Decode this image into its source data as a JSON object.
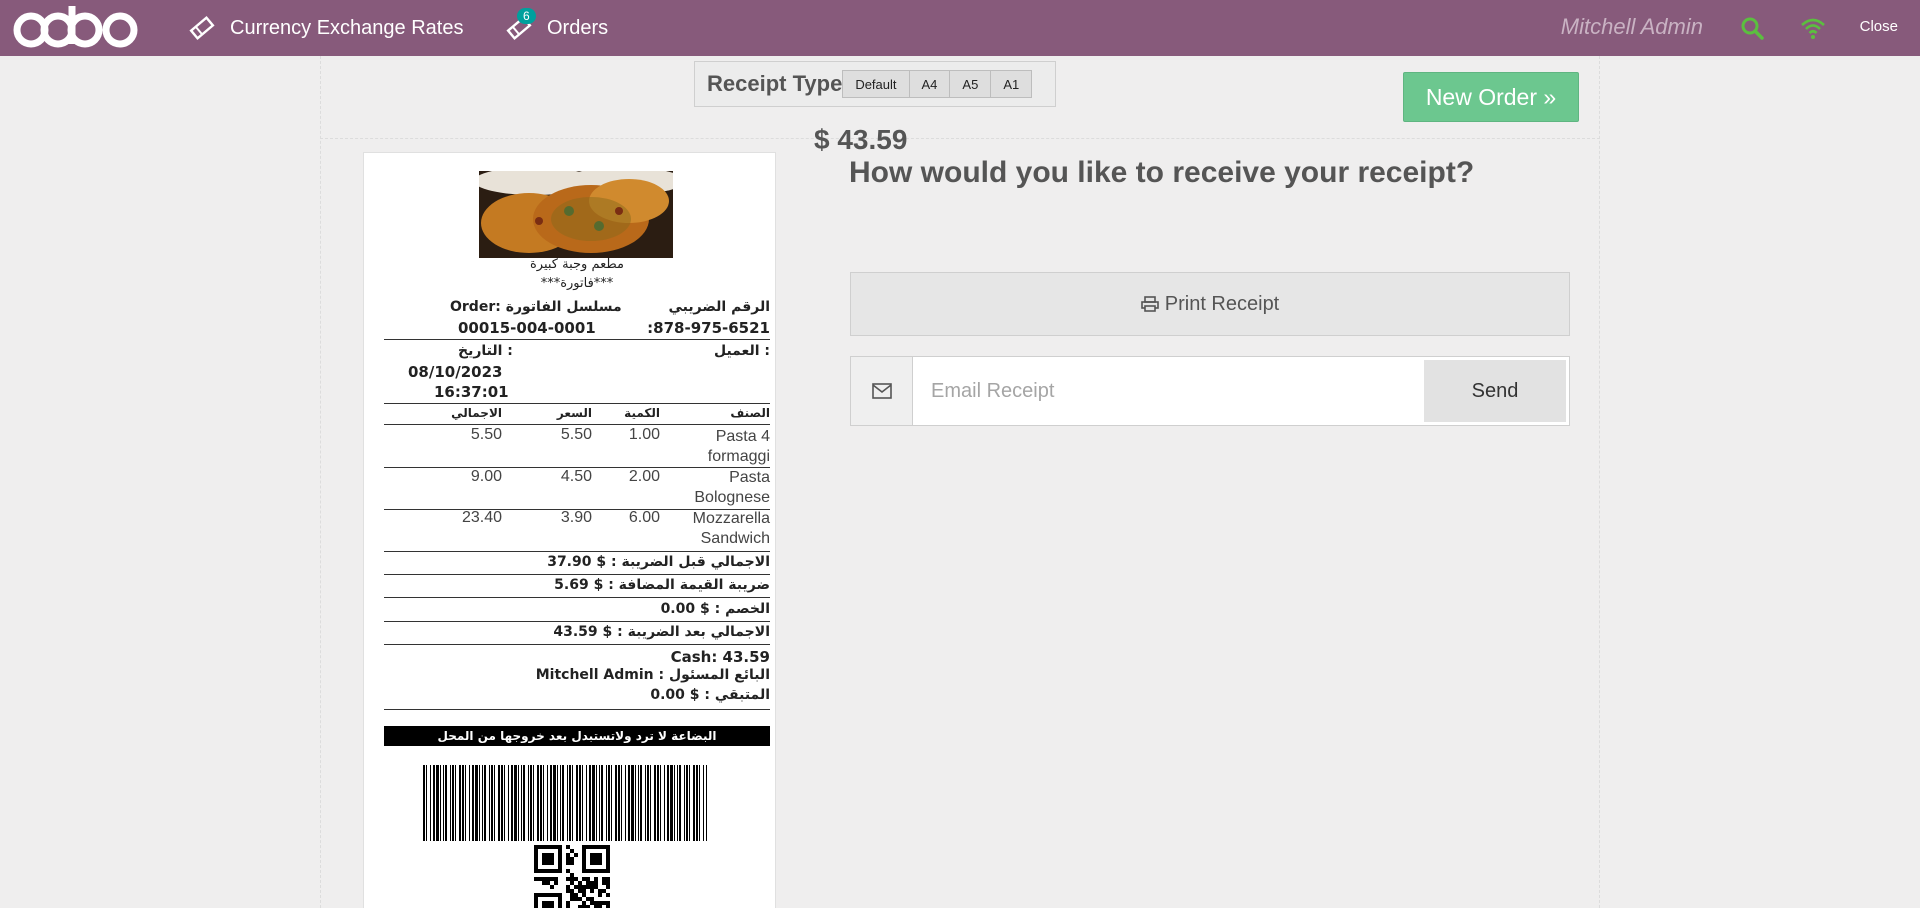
{
  "header": {
    "logo_text": "odoo",
    "nav_rates": "Currency Exchange Rates",
    "nav_orders": "Orders",
    "orders_badge": "6",
    "user": "Mitchell Admin",
    "close": "Close"
  },
  "receipt_type": {
    "label": "Receipt Type",
    "options": [
      "Default",
      "A4",
      "A5",
      "A1"
    ]
  },
  "new_order_label": "New Order »",
  "amount": "$ 43.59",
  "question": "How would you like to receive your receipt?",
  "print_label": "Print Receipt",
  "email": {
    "placeholder": "Email Receipt",
    "send_label": "Send"
  },
  "receipt": {
    "company": "مطعم وجبة كبيرة",
    "doc_title": "***فاتورة***",
    "order_label": "Order: مسلسل الفاتورة",
    "order_number": "00015-004-0001",
    "tax_label": "الرقم الضريبي",
    "tax_number": ":878-975-6521",
    "date_label": "التاريخ :",
    "date": "08/10/2023",
    "time": "16:37:01",
    "customer_label": "العميل :",
    "cols": {
      "product": "الصنف",
      "qty": "الكمية",
      "price": "السعر",
      "total": "الاجمالي"
    },
    "lines": [
      {
        "name": "Pasta 4 formaggi",
        "qty": "1.00",
        "price": "5.50",
        "total": "5.50"
      },
      {
        "name": "Pasta Bolognese",
        "qty": "2.00",
        "price": "4.50",
        "total": "9.00"
      },
      {
        "name": "Mozzarella Sandwich",
        "qty": "6.00",
        "price": "3.90",
        "total": "23.40"
      }
    ],
    "subtotal": "الاجمالي قبل الضريبة : $ 37.90",
    "vat": "ضريبة القيمة المضافة : $ 5.69",
    "discount": "الخصم : $ 0.00",
    "grand_total": "الاجمالي بعد الضريبة : $ 43.59",
    "cash": "Cash: 43.59",
    "cashier": "Mitchell Admin : البائع المسئول",
    "change": "المتبقي : $ 0.00",
    "footer_note": "البضاعة لا ترد ولاتستبدل بعد خروجها من المحل"
  }
}
